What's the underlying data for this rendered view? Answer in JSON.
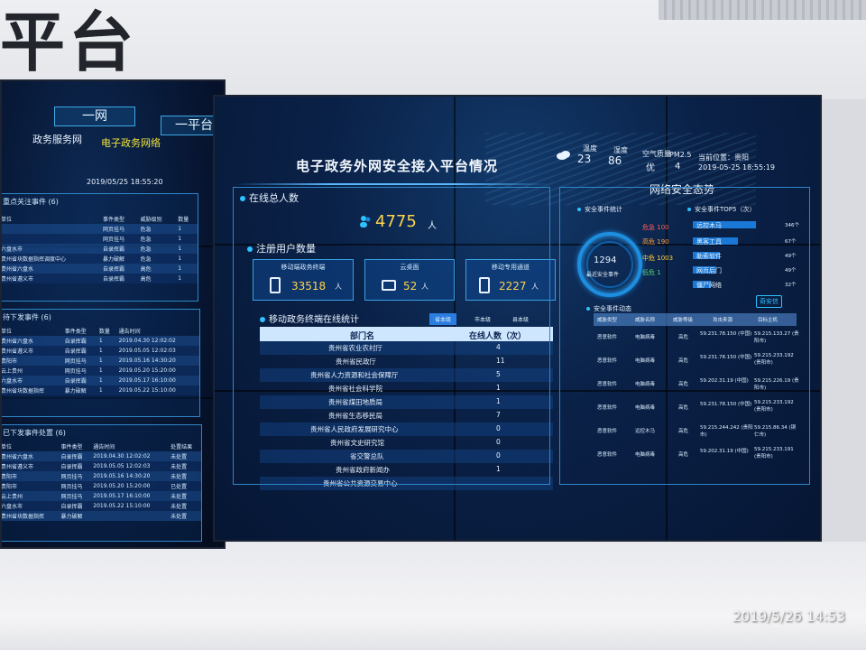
{
  "wall": {
    "title_fragment": "平台"
  },
  "photo_timestamp": "2019/5/26  14:53",
  "left_panel": {
    "tab_one_net": "一网",
    "tab_one_platform": "一平台",
    "sub_tab_gov_service": "政务服务网",
    "sub_tab_egov": "电子政务网络",
    "clock": "2019/05/25   18:55:20",
    "focus_events": {
      "title": "重点关注事件 (6)",
      "headers": [
        "单位",
        "事件类型",
        "威胁级别",
        "数量"
      ],
      "rows": [
        [
          "",
          "网页挂马",
          "危急",
          "1"
        ],
        [
          "",
          "网页挂马",
          "危急",
          "1"
        ],
        [
          "六盘水市",
          "自录挥霸",
          "危急",
          "1"
        ],
        [
          "贵州省块数据指挥调度中心",
          "暴力破解",
          "危急",
          "1"
        ],
        [
          "贵州省六盘水",
          "自录挥霸",
          "高危",
          "1"
        ],
        [
          "贵州省遵义市",
          "自录挥霸",
          "高危",
          "1"
        ]
      ]
    },
    "pending_events": {
      "title": "待下发事件 (6)",
      "headers": [
        "单位",
        "事件类型",
        "数量",
        "通告时间"
      ],
      "rows": [
        [
          "贵州省六盘水",
          "自录挥霸",
          "1",
          "2019.04.30 12:02:02"
        ],
        [
          "贵州省遵义市",
          "自录挥霸",
          "1",
          "2019.05.05 12:02:03"
        ],
        [
          "贵阳市",
          "网页挂马",
          "1",
          "2019.05.16 14:30:20"
        ],
        [
          "云上贵州",
          "网页挂马",
          "1",
          "2019.05.20 15:20:00"
        ],
        [
          "六盘水市",
          "自录挥霸",
          "1",
          "2019.05.17 16:10:00"
        ],
        [
          "贵州省块数据指挥",
          "暴力破解",
          "1",
          "2019.05.22 15:10:00"
        ]
      ]
    },
    "issued_events": {
      "title": "已下发事件处置 (6)",
      "headers": [
        "单位",
        "事件类型",
        "通告时间",
        "处置结果"
      ],
      "rows": [
        [
          "贵州省六盘水",
          "自录挥霸",
          "2019.04.30 12:02:02",
          "未处置"
        ],
        [
          "贵州省遵义市",
          "自录挥霸",
          "2019.05.05 12:02:03",
          "未处置"
        ],
        [
          "贵阳市",
          "网页挂马",
          "2019.05.16 14:30:20",
          "未处置"
        ],
        [
          "贵阳市",
          "网页挂马",
          "2019.05.20 15:20:00",
          "已处置"
        ],
        [
          "云上贵州",
          "网页挂马",
          "2019.05.17 16:10:00",
          "未处置"
        ],
        [
          "六盘水市",
          "自录挥霸",
          "2019.05.22 15:10:00",
          "未处置"
        ],
        [
          "贵州省块数据指挥",
          "暴力破解",
          "",
          "未处置"
        ]
      ]
    }
  },
  "main_panel": {
    "title": "电子政务外网安全接入平台情况",
    "online_total_label": "在线总人数",
    "online_total_value": "4775",
    "online_total_unit": "人",
    "registered_label": "注册用户数量",
    "cards": [
      {
        "label": "移动端政务终端",
        "value": "33518",
        "unit": "人"
      },
      {
        "label": "云桌面",
        "value": "52",
        "unit": "人"
      },
      {
        "label": "移动专用通道",
        "value": "2227",
        "unit": "人"
      }
    ],
    "mobile_stats_label": "移动政务终端在线统计",
    "filters": [
      "省本级",
      "市本级",
      "县本级"
    ],
    "dept_table": {
      "headers": [
        "部门名",
        "在线人数（次）"
      ],
      "rows": [
        [
          "贵州省农业农村厅",
          "4"
        ],
        [
          "贵州省民政厅",
          "11"
        ],
        [
          "贵州省人力资源和社会保障厅",
          "5"
        ],
        [
          "贵州省社会科学院",
          "1"
        ],
        [
          "贵州省煤田地质局",
          "1"
        ],
        [
          "贵州省生态移民局",
          "7"
        ],
        [
          "贵州省人民政府发展研究中心",
          "0"
        ],
        [
          "贵州省文史研究馆",
          "0"
        ],
        [
          "省交警总队",
          "0"
        ],
        [
          "贵州省政府新闻办",
          "1"
        ],
        [
          "贵州省公共资源交易中心",
          ""
        ]
      ]
    }
  },
  "right_panel": {
    "weather": {
      "temp_label": "温度",
      "temp_value": "23",
      "humidity_label": "湿度",
      "humidity_value": "86",
      "air_label": "空气质量",
      "air_value": "优",
      "pm_label": "PM2.5",
      "pm_value": "4",
      "location_label": "当前位置：贵阳",
      "datetime": "2019-05-25   18:55:19"
    },
    "title": "网络安全态势",
    "security_stats_label": "安全事件统计",
    "ring_value": "1294",
    "ring_caption": "最近安全事件",
    "severity": [
      {
        "label": "危急",
        "value": "100",
        "color": "#ff5a5a"
      },
      {
        "label": "高危",
        "value": "190",
        "color": "#ff9a3a"
      },
      {
        "label": "中危",
        "value": "1003",
        "color": "#ffd23a"
      },
      {
        "label": "低危",
        "value": "1",
        "color": "#5ad17a"
      }
    ],
    "top5_label": "安全事件TOP5（次）",
    "top5": [
      {
        "name": "远控木马",
        "value": "346个"
      },
      {
        "name": "黑客工具",
        "value": "67个"
      },
      {
        "name": "勒索软件",
        "value": "49个"
      },
      {
        "name": "网页后门",
        "value": "49个"
      },
      {
        "name": "僵尸网络",
        "value": "32个"
      }
    ],
    "safe_badge": "奇安信",
    "dynamics_label": "安全事件动态",
    "dynamics_headers": [
      "威胁类型",
      "威胁名称",
      "威胁等级",
      "攻击来源",
      "目标主机"
    ],
    "dynamics_rows": [
      [
        "恶意软件",
        "电脑病毒",
        "高危",
        "59.231.78.150 (中国)",
        "59.215.133.27 (贵阳市)"
      ],
      [
        "恶意软件",
        "电脑病毒",
        "高危",
        "59.231.78.150 (中国)",
        "59.215.233.192 (贵阳市)"
      ],
      [
        "恶意软件",
        "电脑病毒",
        "高危",
        "59.202.31.19 (中国)",
        "59.215.226.19 (贵阳市)"
      ],
      [
        "恶意软件",
        "电脑病毒",
        "高危",
        "59.231.78.150 (中国)",
        "59.215.233.192 (贵阳市)"
      ],
      [
        "恶意软件",
        "远控木马",
        "高危",
        "59.215.244.242 (贵阳市)",
        "59.215.86.34 (铜仁市)"
      ],
      [
        "恶意软件",
        "电脑病毒",
        "高危",
        "59.202.31.19 (中国)",
        "59.215.233.191 (贵阳市)"
      ]
    ]
  }
}
